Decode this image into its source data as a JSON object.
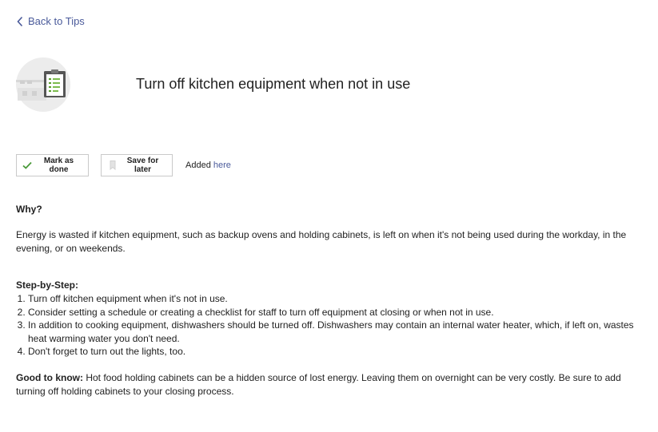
{
  "nav": {
    "back_label": "Back to Tips"
  },
  "tip": {
    "title": "Turn off kitchen equipment when not in use"
  },
  "actions": {
    "mark_done_label": "Mark as done",
    "save_label": "Save for later",
    "added_prefix": "Added",
    "added_link": "here"
  },
  "why": {
    "heading": "Why?",
    "body": "Energy is wasted if kitchen equipment, such as backup ovens and holding cabinets, is left on when it's not being used during the workday, in the evening, or on weekends."
  },
  "steps": {
    "heading": "Step-by-Step:",
    "items": [
      "Turn off kitchen equipment when it's not in use.",
      "Consider setting a schedule or creating a checklist for staff to turn off equipment at closing or when not in use.",
      "In addition to cooking equipment, dishwashers should be turned off. Dishwashers may contain an internal water heater, which, if left on, wastes heat warming water you don't need.",
      "Don't forget to turn out the lights, too."
    ]
  },
  "good_to_know": {
    "label": "Good to know:",
    "body": "Hot food holding cabinets can be a hidden source of lost energy. Leaving them on overnight can be very costly. Be sure to add turning off holding cabinets to your closing process."
  },
  "icons": {
    "back": "chevron-left-icon",
    "hero": "kitchen-checklist-illustration",
    "done": "check-icon",
    "save": "bookmark-icon"
  },
  "colors": {
    "link": "#4a5a9a",
    "check": "#4a9a3a",
    "border": "#c9c9c9"
  }
}
